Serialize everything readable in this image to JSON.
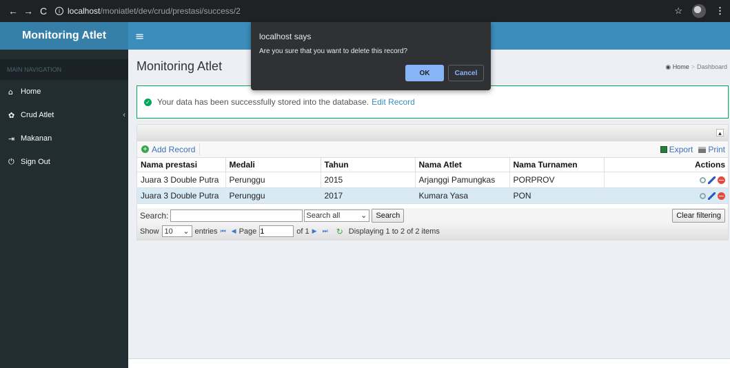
{
  "browser": {
    "url_host": "localhost",
    "url_path": "/moniatlet/dev/crud/prestasi/success/2"
  },
  "app": {
    "logo": "Monitoring Atlet"
  },
  "sidebar": {
    "header": "MAIN NAVIGATION",
    "items": [
      {
        "label": "Home",
        "icon": "home-icon"
      },
      {
        "label": "Crud Atlet",
        "icon": "gear-icon"
      },
      {
        "label": "Makanan",
        "icon": "sign-in-icon"
      },
      {
        "label": "Sign Out",
        "icon": "power-icon"
      }
    ]
  },
  "page": {
    "title": "Monitoring Atlet",
    "breadcrumb": [
      "Home",
      "Dashboard"
    ]
  },
  "alert": {
    "message": "Your data has been successfully stored into the database.",
    "link": "Edit Record"
  },
  "grid": {
    "add_label": "Add Record",
    "export_label": "Export",
    "print_label": "Print",
    "columns": [
      "Nama prestasi",
      "Medali",
      "Tahun",
      "Nama Atlet",
      "Nama Turnamen",
      "Actions"
    ],
    "rows": [
      [
        "Juara 3 Double Putra",
        "Perunggu",
        "2015",
        "Arjanggi Pamungkas",
        "PORPROV"
      ],
      [
        "Juara 3 Double Putra",
        "Perunggu",
        "2017",
        "Kumara Yasa",
        "PON"
      ]
    ],
    "search_label": "Search:",
    "search_value": "",
    "search_field": "Search all",
    "search_button": "Search",
    "clear_button": "Clear filtering",
    "show_label": "Show",
    "entries_value": "10",
    "entries_label": "entries",
    "page_label": "Page",
    "page_value": "1",
    "of_label": "of 1",
    "displaying": "Displaying 1 to 2 of 2 items"
  },
  "dialog": {
    "title": "localhost says",
    "message": "Are you sure that you want to delete this record?",
    "ok": "OK",
    "cancel": "Cancel"
  },
  "colors": {
    "header": "#3c8dbc",
    "logo_bg": "#367fa9",
    "sidebar_bg": "#222d32",
    "alert_border": "#00a65a",
    "dialog_bg": "#2f3135",
    "dialog_ok": "#8ab4f8"
  }
}
